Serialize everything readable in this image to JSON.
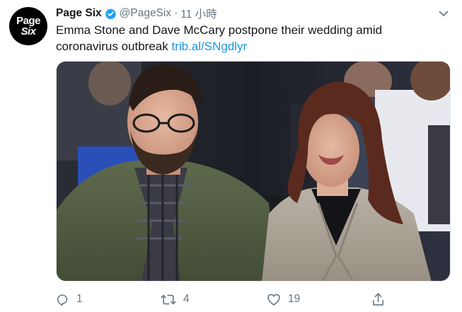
{
  "tweet": {
    "avatar_text_line1": "Page",
    "avatar_text_line2": "Six",
    "display_name": "Page Six",
    "handle": "@PageSix",
    "separator": "·",
    "time": "11 小時",
    "text": "Emma Stone and Dave McCary postpone their wedding amid coronavirus outbreak ",
    "link": "trib.al/SNgdlyr",
    "replies": "1",
    "retweets": "4",
    "likes": "19"
  },
  "icons": {
    "verified": "verified-badge-icon",
    "caret": "chevron-down-icon",
    "reply": "reply-icon",
    "retweet": "retweet-icon",
    "like": "heart-icon",
    "share": "share-icon"
  },
  "colors": {
    "text": "#14171a",
    "secondary": "#657786",
    "link": "#1b95e0",
    "verified": "#1da1f2"
  }
}
